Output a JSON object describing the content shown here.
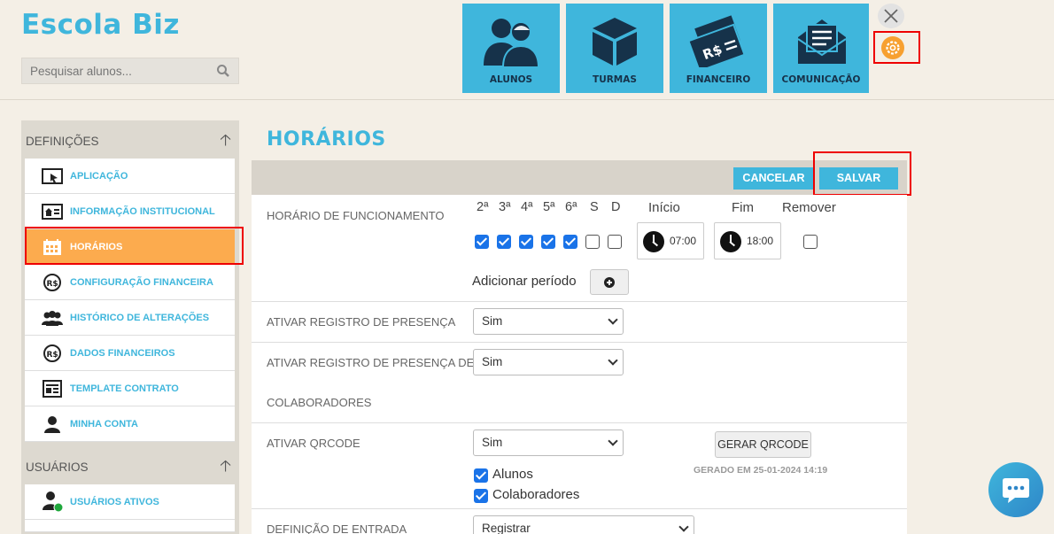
{
  "header": {
    "brand": "Escola Biz",
    "search_placeholder": "Pesquisar alunos...",
    "tiles": [
      {
        "label": "ALUNOS",
        "icon": "students-icon"
      },
      {
        "label": "TURMAS",
        "icon": "box-icon"
      },
      {
        "label": "FINANCEIRO",
        "icon": "money-icon"
      },
      {
        "label": "COMUNICAÇÃO",
        "icon": "envelope-icon"
      }
    ]
  },
  "sidebar": {
    "sections": [
      {
        "title": "DEFINIÇÕES",
        "items": [
          {
            "label": "APLICAÇÃO",
            "icon": "cursor-window-icon"
          },
          {
            "label": "INFORMAÇÃO INSTITUCIONAL",
            "icon": "institution-icon"
          },
          {
            "label": "HORÁRIOS",
            "icon": "calendar-icon",
            "active": true
          },
          {
            "label": "CONFIGURAÇÃO FINANCEIRA",
            "icon": "money-circle-icon"
          },
          {
            "label": "HISTÓRICO DE ALTERAÇÕES",
            "icon": "group-icon"
          },
          {
            "label": "DADOS FINANCEIROS",
            "icon": "money-circle-icon"
          },
          {
            "label": "TEMPLATE CONTRATO",
            "icon": "document-icon"
          },
          {
            "label": "MINHA CONTA",
            "icon": "user-icon"
          }
        ]
      },
      {
        "title": "USUÁRIOS",
        "items": [
          {
            "label": "USUÁRIOS ATIVOS",
            "icon": "active-user-icon"
          }
        ]
      }
    ]
  },
  "main": {
    "title": "HORÁRIOS",
    "toolbar": {
      "cancel": "CANCELAR",
      "save": "SALVAR"
    },
    "schedule": {
      "label": "HORÁRIO DE FUNCIONAMENTO",
      "days": [
        {
          "label": "2ª",
          "checked": true
        },
        {
          "label": "3ª",
          "checked": true
        },
        {
          "label": "4ª",
          "checked": true
        },
        {
          "label": "5ª",
          "checked": true
        },
        {
          "label": "6ª",
          "checked": true
        },
        {
          "label": "S",
          "checked": false
        },
        {
          "label": "D",
          "checked": false
        }
      ],
      "start_header": "Início",
      "end_header": "Fim",
      "remove_header": "Remover",
      "start_value": "07:00",
      "end_value": "18:00",
      "add_period": "Adicionar período"
    },
    "presence": {
      "label": "ATIVAR REGISTRO DE PRESENÇA",
      "value": "Sim"
    },
    "collab_presence": {
      "label": "ATIVAR REGISTRO DE PRESENÇA DE",
      "label_cont": "COLABORADORES",
      "value": "Sim"
    },
    "qrcode": {
      "label": "ATIVAR QRCODE",
      "value": "Sim",
      "generate": "GERAR QRCODE",
      "generated": "GERADO EM 25-01-2024 14:19",
      "students": "Alunos",
      "collaborators": "Colaboradores"
    },
    "entry": {
      "label": "DEFINIÇÃO DE ENTRADA",
      "value": "Registrar"
    }
  },
  "colors": {
    "accent": "#3fb6dc",
    "active": "#fcab4e",
    "highlight": "#e00000"
  }
}
